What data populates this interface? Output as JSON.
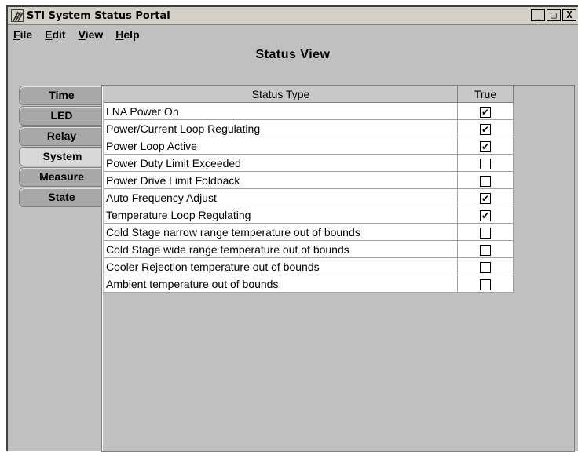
{
  "window": {
    "title": "STI System Status Portal",
    "controls": {
      "minimize": "_",
      "maximize": "□",
      "close": "X"
    }
  },
  "menu": {
    "file": {
      "mnemonic": "F",
      "rest": "ile"
    },
    "edit": {
      "mnemonic": "E",
      "rest": "dit"
    },
    "view": {
      "mnemonic": "V",
      "rest": "iew"
    },
    "help": {
      "mnemonic": "H",
      "rest": "elp"
    }
  },
  "panel": {
    "title": "Status View"
  },
  "tabs": [
    "Time",
    "LED",
    "Relay",
    "System",
    "Measure",
    "State"
  ],
  "active_tab": "System",
  "table": {
    "columns": [
      "Status Type",
      "True"
    ],
    "rows": [
      {
        "label": "LNA Power On",
        "checked": true
      },
      {
        "label": "Power/Current Loop Regulating",
        "checked": true
      },
      {
        "label": "Power Loop Active",
        "checked": true
      },
      {
        "label": "Power Duty Limit Exceeded",
        "checked": false
      },
      {
        "label": "Power Drive Limit Foldback",
        "checked": false
      },
      {
        "label": "Auto Frequency Adjust",
        "checked": true
      },
      {
        "label": "Temperature Loop Regulating",
        "checked": true
      },
      {
        "label": "Cold Stage narrow range temperature out of bounds",
        "checked": false
      },
      {
        "label": "Cold Stage wide range temperature out of bounds",
        "checked": false
      },
      {
        "label": "Cooler Rejection temperature out of bounds",
        "checked": false
      },
      {
        "label": "Ambient temperature out of bounds",
        "checked": false
      }
    ],
    "check_glyph": "✔"
  }
}
